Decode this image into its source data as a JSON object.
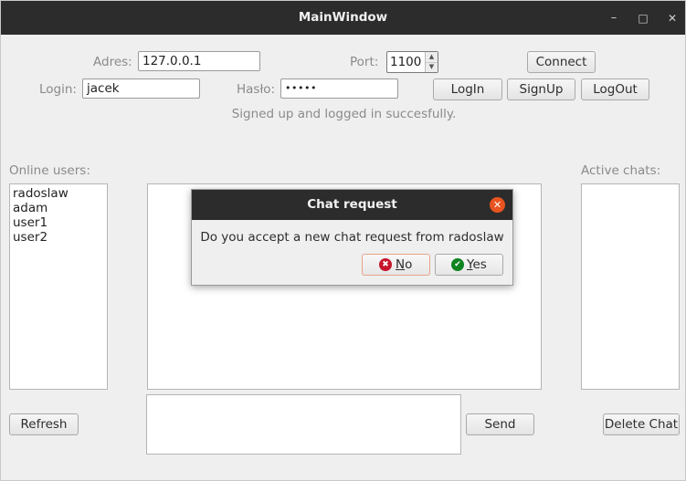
{
  "window": {
    "title": "MainWindow",
    "minimize": "–",
    "maximize": "□",
    "close": "✕"
  },
  "connection": {
    "address_label": "Adres:",
    "address_value": "127.0.0.1",
    "port_label": "Port:",
    "port_value": "1100",
    "connect_label": "Connect"
  },
  "auth": {
    "login_label": "Login:",
    "login_value": "jacek",
    "password_label": "Hasło:",
    "password_value": "•••••",
    "login_button": "LogIn",
    "signup_button": "SignUp",
    "logout_button": "LogOut"
  },
  "status_text": "Signed up and logged in succesfully.",
  "online_users": {
    "label": "Online users:",
    "items": [
      "radoslaw",
      "adam",
      "user1",
      "user2"
    ]
  },
  "active_chats": {
    "label": "Active chats:"
  },
  "buttons": {
    "refresh": "Refresh",
    "send": "Send",
    "delete_chat": "Delete Chat"
  },
  "dialog": {
    "title": "Chat request",
    "message": "Do you accept a new chat request from radoslaw",
    "no_mnemonic": "N",
    "no_rest": "o",
    "yes_mnemonic": "Y",
    "yes_rest": "es",
    "no_icon": "✖",
    "yes_icon": "✔"
  },
  "colors": {
    "titlebar": "#2c2c2c",
    "close_accent": "#e95420",
    "no_icon": "#c7162b",
    "yes_icon": "#0e8420"
  }
}
